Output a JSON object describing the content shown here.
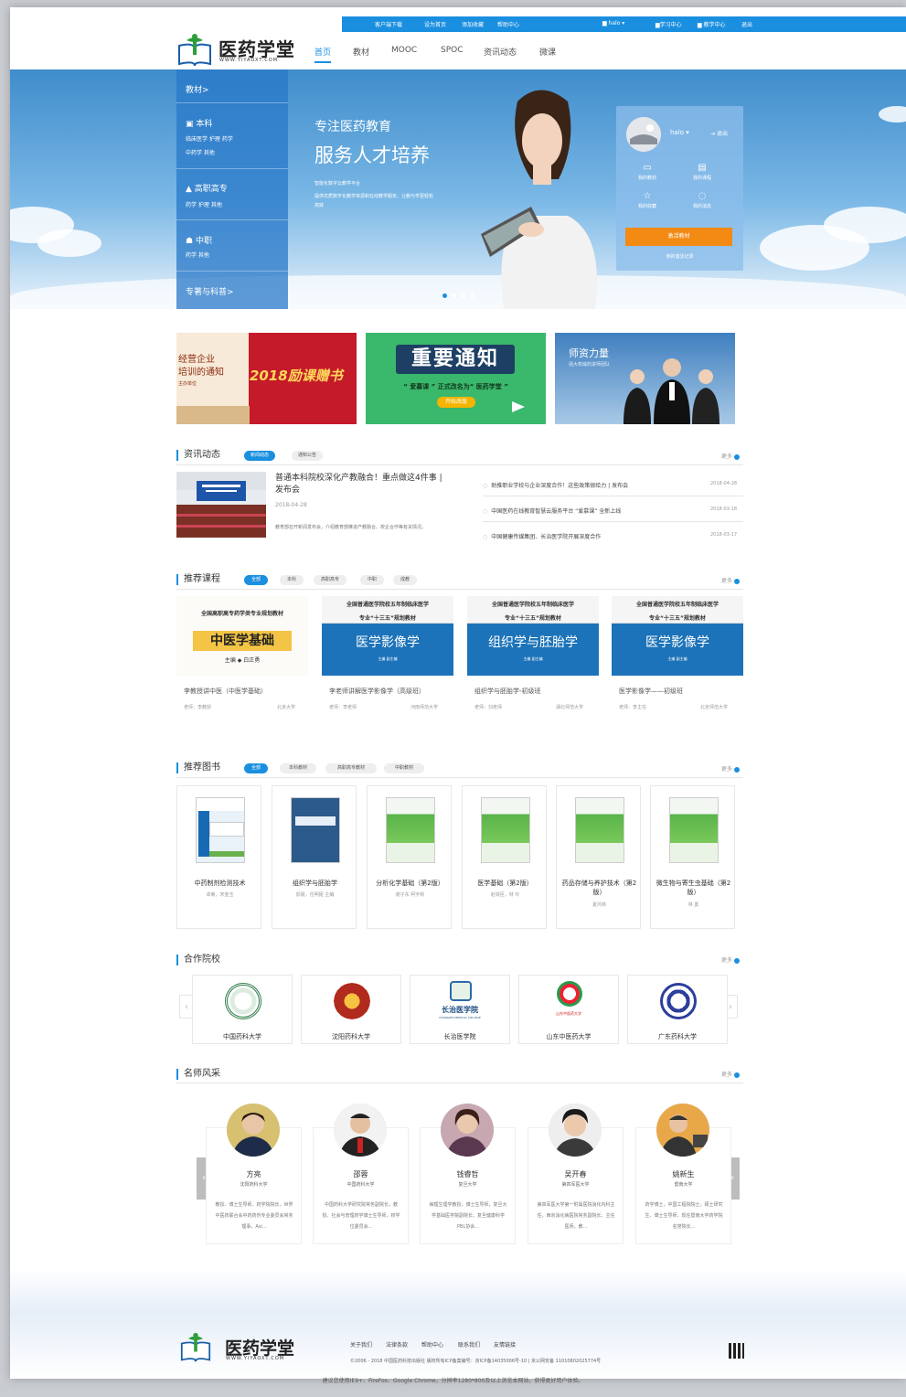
{
  "topbar": {
    "items": [
      "客户端下载",
      "设为首页",
      "添加收藏",
      "帮助中心"
    ],
    "user": "halo",
    "study": "学习中心",
    "teach": "教学中心",
    "exit": "退出"
  },
  "logo": {
    "brand": "医药学堂",
    "url": "WWW.YIYAOXT.COM"
  },
  "nav": [
    {
      "label": "首页",
      "active": true
    },
    {
      "label": "教材"
    },
    {
      "label": "MOOC"
    },
    {
      "label": "SPOC"
    },
    {
      "label": "资讯动态"
    },
    {
      "label": "微课"
    }
  ],
  "side": {
    "head": "教材>",
    "bk": "本科",
    "bk_sub1": "临床医学  护理  药学",
    "bk_sub2": "中药学  其他",
    "gz": "高职高专",
    "gz_sub": "药学  护理  其他",
    "zz": "中职",
    "zz_sub": "药学  其他",
    "foot": "专著与科普>"
  },
  "hero": {
    "s1": "专注医药教育",
    "s2": "服务人才培养",
    "small1": "智能化数字云教学平台",
    "small2": "提供优质数字化教学资源和在线教学服务，让教与学更轻松",
    "small3": "高效"
  },
  "card": {
    "user": "halo",
    "logout": "退出",
    "i1": "我的教材",
    "i2": "我的课程",
    "i3": "我的收藏",
    "i4": "我的消息",
    "btn": "激活教材",
    "link": "我的激活记录"
  },
  "banners": {
    "b1a": "经营企业",
    "b1b": "培训的通知",
    "b1c": "主办单位",
    "b1d": "2018励课赠书",
    "b2a": "重要通知",
    "b2b": "“ 爱慕课 ” 正式改名为“ 医药学堂 ”",
    "b2c": "开始改版",
    "b3a": "师资力量",
    "b3b": "强大权威的讲师团队"
  },
  "news": {
    "title": "资讯动态",
    "tabs": [
      "新闻动态",
      "通知公告"
    ],
    "more": "更多",
    "head": "普通本科院校深化产教融合！重点做这4件事 | 发布会",
    "date": "2018-04-28",
    "summary": "教育部召开新闻发布会，介绍教育部推进产教融合、校企合作等有关情况。",
    "list": [
      {
        "t": "助推职业学校与企业深度合作！这些政策很给力 | 发布会",
        "d": "2018-04-28"
      },
      {
        "t": "中国医药在线教育智慧云服务平台 “爱慕课” 全新上线",
        "d": "2018-03-18"
      },
      {
        "t": "中国健康传媒集团、长治医学院开展深度合作",
        "d": "2018-03-17"
      }
    ]
  },
  "courses": {
    "title": "推荐课程",
    "tabs": [
      "全部",
      "本科",
      "高职高专",
      "中职",
      "成教"
    ],
    "more": "更多",
    "c1": {
      "band": "全国高职高专药学类专业规划教材",
      "name": "中医学基础",
      "editor": "主编 ◆ 白正勇",
      "title": "李教授讲中医（中医学基础）",
      "teacher": "老师：李教授",
      "school": "北京大学"
    },
    "c2": {
      "band1": "全国普通医学院校五年制临床医学",
      "band2": "专业“十三五”规划教材",
      "name": "医学影像学",
      "editor": "主编  副主编",
      "title": "李老师讲解医学影像学（高级班）",
      "teacher": "老师：李老师",
      "school": "河南师范大学"
    },
    "c3": {
      "band1": "全国普通医学院校五年制临床医学",
      "band2": "专业“十三五”规划教材",
      "name": "组织学与胚胎学",
      "editor": "主编  副主编",
      "title": "组织学与胚胎学-初级班",
      "teacher": "老师：刘老师",
      "school": "湖北师范大学"
    },
    "c4": {
      "band1": "全国普通医学院校五年制临床医学",
      "band2": "专业“十三五”规划教材",
      "name": "医学影像学",
      "editor": "主编  副主编",
      "title": "医学影像学——初级班",
      "teacher": "老师：李主任",
      "school": "北京师范大学"
    }
  },
  "books": {
    "title": "推荐图书",
    "tabs": [
      "全部",
      "本科教材",
      "高职高专教材",
      "中职教材"
    ],
    "more": "更多",
    "items": [
      {
        "t": "中药制剂检测技术",
        "a": "卓菊，宋金玉"
      },
      {
        "t": "组织学与胚胎学",
        "a": "邸晨，任明姬 主编"
      },
      {
        "t": "分析化学基础（第2版）",
        "a": "谢子东 柯宇新"
      },
      {
        "t": "医学基础（第2版）",
        "a": "赵铁臣，林 玲"
      },
      {
        "t": "药品存储与养护技术（第2版）",
        "a": "夏鸿林"
      },
      {
        "t": "微生物与寄生虫基础（第2版）",
        "a": "林 勇"
      }
    ]
  },
  "schools": {
    "title": "合作院校",
    "more": "更多",
    "items": [
      "中国药科大学",
      "沈阳药科大学",
      "长治医学院",
      "山东中医药大学",
      "广东药科大学"
    ],
    "s3logo": "长治医学院",
    "s3en": "CHANGZHI MEDICAL COLLEGE",
    "s4logo": "山东中医药大学"
  },
  "teachers": {
    "title": "名师风采",
    "more": "更多",
    "items": [
      {
        "n": "方亮",
        "s": "沈阳药科大学",
        "d": "教授、博士生导师、药学院院长，世界中医药联合会中药药剂专业委员会常务理事，Asi..."
      },
      {
        "n": "邵蓉",
        "s": "中国药科大学",
        "d": "中国药科大学研究院常务副院长，教授、社会与管理药学博士生导师，校学位委员会..."
      },
      {
        "n": "钱睿哲",
        "s": "复旦大学",
        "d": "病理生理学教授，博士生导师，复旦大学基础医学院副院长，复旦健康科学PBL协会..."
      },
      {
        "n": "吴开春",
        "s": "第四军医大学",
        "d": "第四军医大学第一附属医院消化内科主任，西京消化病医院常务副院长、主任医师，教..."
      },
      {
        "n": "姚新生",
        "s": "暨南大学",
        "d": "药学博士，中国工程院院士，硕士研究生、博士生导师，现任暨南大学药学院名誉院长..."
      }
    ]
  },
  "footer": {
    "brand": "医药学堂",
    "url": "WWW.YIYAOXT.COM",
    "links": [
      "关于我们",
      "法律条款",
      "帮助中心",
      "联系我们",
      "友情链接"
    ],
    "copy": "©2006 - 2018 中国医药科技出版社 版权所有ICP备案编号：京ICP备14035006号-10 | 京公网安备 11010802025774号",
    "tip": "建议您使用IE9+、FireFox、Google Chrome，分辨率1280*800及以上浏览本网站，获得更好用户体验。"
  },
  "colors": {
    "accent": "#1a8fe0",
    "orange": "#f28a13",
    "cover": "#1c73b9"
  }
}
